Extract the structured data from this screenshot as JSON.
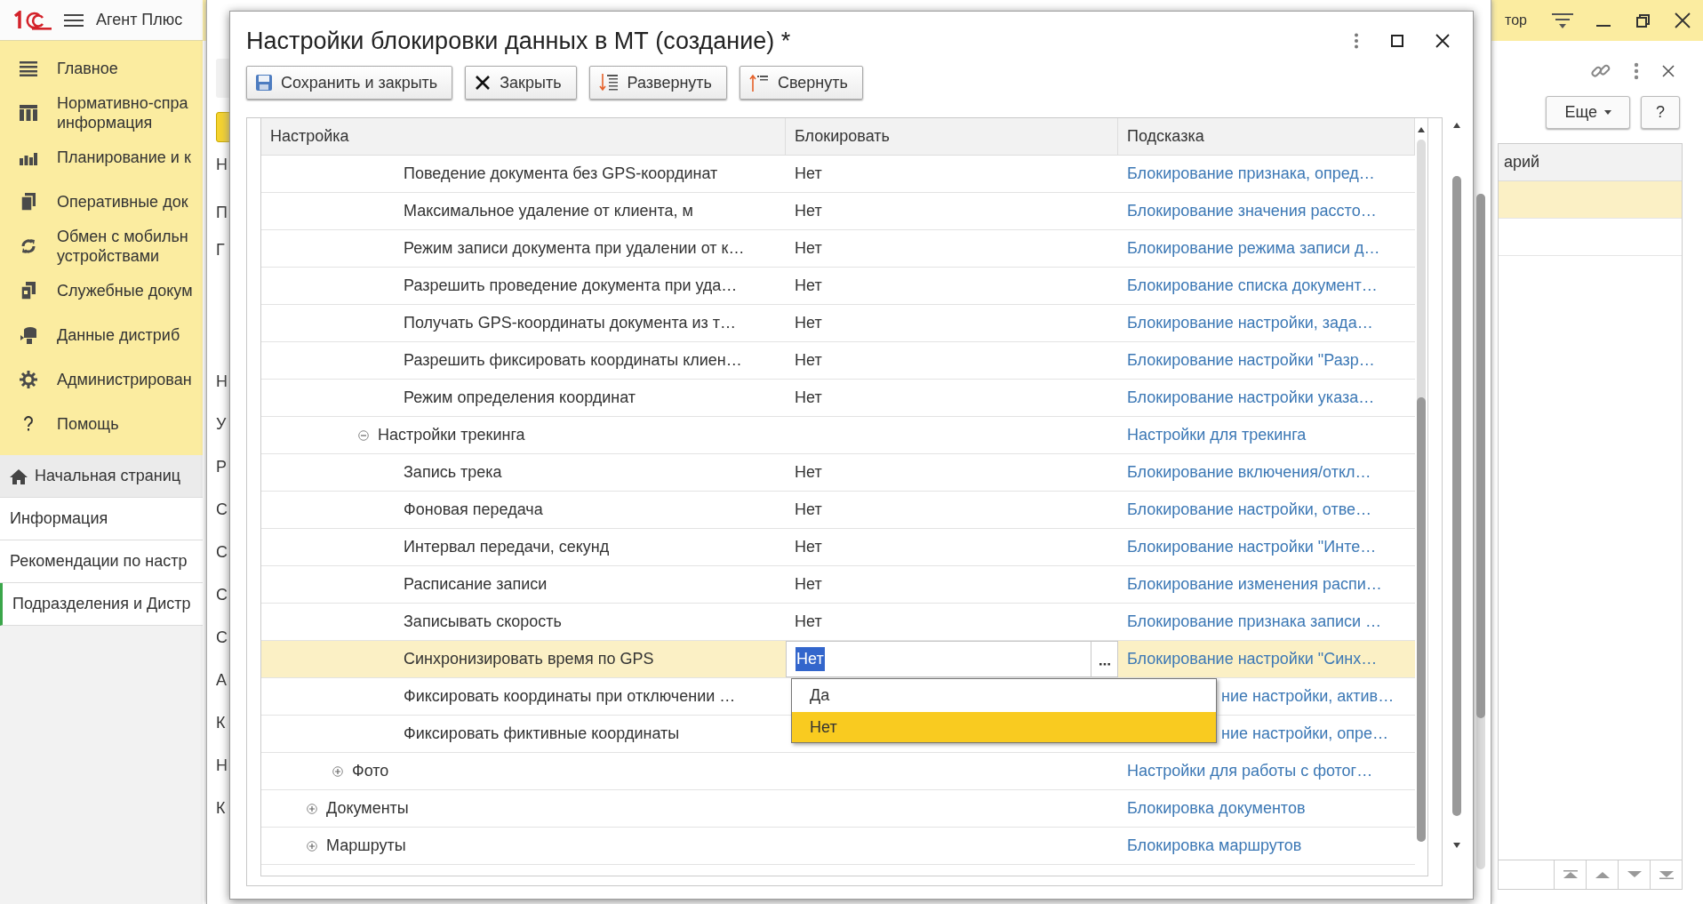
{
  "app": {
    "title": "Агент Плюс"
  },
  "sidebar": {
    "sections": [
      {
        "label": "Главное"
      },
      {
        "label": "Нормативно-спра\nинформация"
      },
      {
        "label": "Планирование и к"
      },
      {
        "label": "Оперативные док"
      },
      {
        "label": "Обмен с мобильн\nустройствами"
      },
      {
        "label": "Служебные докум"
      },
      {
        "label": "Данные дистриб"
      },
      {
        "label": "Администрирован"
      },
      {
        "label": "Помощь"
      }
    ],
    "open_pages": [
      {
        "label": "Начальная страниц",
        "kind": "home",
        "selected": false
      },
      {
        "label": "Информация",
        "kind": "page",
        "selected": false
      },
      {
        "label": "Рекомендации по настр",
        "kind": "page",
        "selected": false
      },
      {
        "label": "Подразделения и Дистр",
        "kind": "page",
        "selected": true
      }
    ]
  },
  "background_form": {
    "letters": [
      "Н",
      "П",
      "Г",
      "Н",
      "У",
      "Р",
      "С",
      "С",
      "С",
      "С",
      "А",
      "К",
      "Н",
      "К"
    ]
  },
  "right_panel": {
    "top_text": "тор",
    "more_button": "Еще",
    "help_button": "?",
    "column": "арий"
  },
  "dialog": {
    "title": "Настройки блокировки данных в МТ (создание) *",
    "toolbar": [
      {
        "label": "Сохранить и закрыть"
      },
      {
        "label": "Закрыть"
      },
      {
        "label": "Развернуть"
      },
      {
        "label": "Свернуть"
      }
    ],
    "table": {
      "columns": [
        "Настройка",
        "Блокировать",
        "Подсказка"
      ],
      "tree": [
        {
          "children": [
            {
              "children": [
                {
                  "children": [
                    {
                      "label": "Поведение документа без GPS-координат",
                      "value": "Нет",
                      "hint": "Блокирование признака, опред…",
                      "selected": false
                    },
                    {
                      "label": "Максимальное удаление от клиента, м",
                      "value": "Нет",
                      "hint": "Блокирование значения рассто…",
                      "selected": false
                    },
                    {
                      "label": "Режим записи документа при удалении от к…",
                      "value": "Нет",
                      "hint": "Блокирование режима записи д…",
                      "selected": false
                    },
                    {
                      "label": "Разрешить проведение документа при уда…",
                      "value": "Нет",
                      "hint": "Блокирование списка документ…",
                      "selected": false
                    },
                    {
                      "label": "Получать GPS-координаты документа из т…",
                      "value": "Нет",
                      "hint": "Блокирование настройки, зада…",
                      "selected": false
                    },
                    {
                      "label": "Разрешить фиксировать координаты клиен…",
                      "value": "Нет",
                      "hint": "Блокирование настройки \"Разр…",
                      "selected": false
                    },
                    {
                      "label": "Режим определения координат",
                      "value": "Нет",
                      "hint": "Блокирование настройки указа…",
                      "selected": false
                    }
                  ]
                },
                {
                  "label": "Настройки трекинга",
                  "hint": "Настройки для трекинга",
                  "expanded": true,
                  "selected": false,
                  "children": [
                    {
                      "label": "Запись трека",
                      "value": "Нет",
                      "hint": "Блокирование включения/откл…",
                      "selected": false
                    },
                    {
                      "label": "Фоновая передача",
                      "value": "Нет",
                      "hint": "Блокирование настройки, отве…",
                      "selected": false
                    },
                    {
                      "label": "Интервал передачи, секунд",
                      "value": "Нет",
                      "hint": "Блокирование настройки \"Инте…",
                      "selected": false
                    },
                    {
                      "label": "Расписание записи",
                      "value": "Нет",
                      "hint": "Блокирование изменения распи…",
                      "selected": false
                    },
                    {
                      "label": "Записывать скорость",
                      "value": "Нет",
                      "hint": "Блокирование признака записи …",
                      "selected": false
                    },
                    {
                      "label": "Синхронизировать время по GPS",
                      "value": "Нет",
                      "hint": "Блокирование настройки \"Синх…",
                      "selected": true
                    },
                    {
                      "label": "Фиксировать координаты при отключении …",
                      "hint": "ние настройки, актив…",
                      "selected": false
                    },
                    {
                      "label": "Фиксировать фиктивные координаты",
                      "hint": "ние настройки, опре…",
                      "selected": false
                    }
                  ]
                }
              ]
            },
            {
              "label": "Фото",
              "hint": "Настройки для работы с фотог…",
              "expanded": false,
              "selected": false
            }
          ]
        },
        {
          "label": "Документы",
          "hint": "Блокировка документов",
          "expanded": false,
          "selected": false
        },
        {
          "label": "Маршруты",
          "hint": "Блокировка маршрутов",
          "expanded": false,
          "selected": false
        }
      ],
      "dropdown": {
        "options": [
          {
            "label": "Да",
            "selected": false
          },
          {
            "label": "Нет",
            "selected": true
          }
        ]
      }
    }
  }
}
